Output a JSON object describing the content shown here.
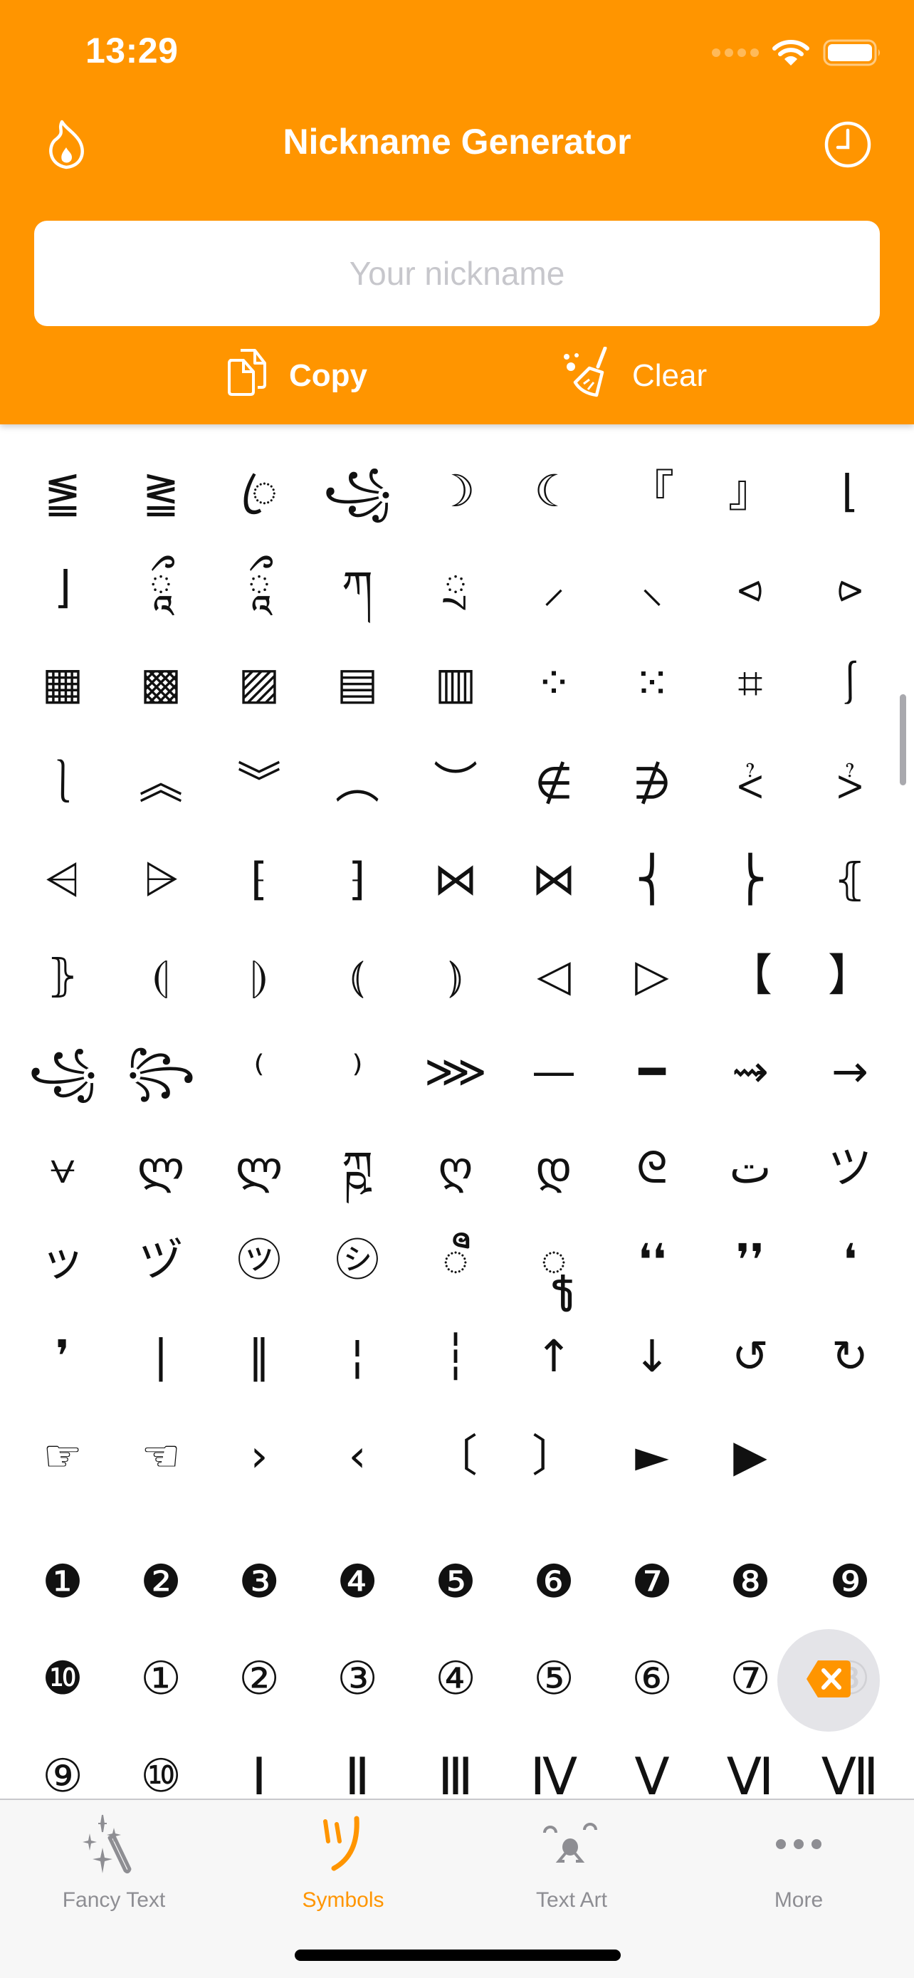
{
  "status_bar": {
    "time": "13:29",
    "icons": [
      "signal-dots-icon",
      "wifi-icon",
      "battery-icon"
    ]
  },
  "header": {
    "title": "Nickname Generator",
    "left_icon": "flame-icon",
    "right_icon": "clock-history-icon",
    "input": {
      "value": "",
      "placeholder": "Your nickname"
    },
    "copy_label": "Copy",
    "copy_icon": "copy-documents-icon",
    "clear_label": "Clear",
    "clear_icon": "broom-icon"
  },
  "colors": {
    "accent": "#FF9500",
    "tab_inactive": "#8E8E93",
    "placeholder": "#C7C7CC"
  },
  "symbols": [
    [
      "⪑",
      "⪒",
      "ꦿ",
      "꧁",
      "☽",
      "☾",
      "『",
      "』",
      "⌊"
    ],
    [
      "⌋",
      "ཱྀ",
      "ཱྀ",
      "ཀ",
      "ྲ",
      "⸝",
      "⸜",
      "⪦",
      "⪧"
    ],
    [
      "▦",
      "▩",
      "▨",
      "▤",
      "▥",
      "⁘",
      "⁙",
      "⌗",
      "⎰"
    ],
    [
      "⎱",
      "︽",
      "︾",
      "︵",
      "︶",
      "∉",
      "∌",
      "⩻",
      "⩼"
    ],
    [
      "⩤",
      "⩥",
      "⁅",
      "⁆",
      "⋈",
      "⋈",
      "⎨",
      "⎬",
      "⦃"
    ],
    [
      "⦄",
      "⦇",
      "⦈",
      "⦅",
      "⦆",
      "◁",
      "▷",
      "【",
      "】"
    ],
    [
      "꧁",
      "꧂",
      "⁽",
      "⁾",
      "⋙",
      "—",
      "━",
      "⇝",
      "→"
    ],
    [
      "⩝",
      "ლ",
      "ლ",
      "ཀྵ",
      "ღ",
      "დ",
      "ᘓ",
      "ت",
      "ツ"
    ],
    [
      "ッ",
      "ヅ",
      "㋡",
      "㋛",
      "ꦷ",
      "ꦹ",
      "❛❛",
      "❜❜",
      "❛"
    ],
    [
      "❜",
      "|",
      "‖",
      "¦",
      "┆",
      "↑",
      "↓",
      "↺",
      "↻"
    ],
    [
      "☞",
      "☜",
      "›",
      "‹",
      "〔",
      "〕",
      "►",
      "▶",
      ""
    ]
  ],
  "numbers": [
    [
      "❶",
      "❷",
      "❸",
      "❹",
      "❺",
      "❻",
      "❼",
      "❽",
      "❾"
    ],
    [
      "❿",
      "①",
      "②",
      "③",
      "④",
      "⑤",
      "⑥",
      "⑦",
      "⑧"
    ],
    [
      "⑨",
      "⑩",
      "Ⅰ",
      "Ⅱ",
      "Ⅲ",
      "Ⅳ",
      "Ⅴ",
      "Ⅵ",
      "Ⅶ"
    ]
  ],
  "delete_button": {
    "icon": "backspace-icon"
  },
  "tabs": [
    {
      "label": "Fancy Text",
      "icon": "magic-wand-icon",
      "active": false
    },
    {
      "label": "Symbols",
      "icon": "tsu-symbol-icon",
      "active": true
    },
    {
      "label": "Text Art",
      "icon": "bear-face-icon",
      "active": false
    },
    {
      "label": "More",
      "icon": "more-dots-icon",
      "active": false
    }
  ]
}
